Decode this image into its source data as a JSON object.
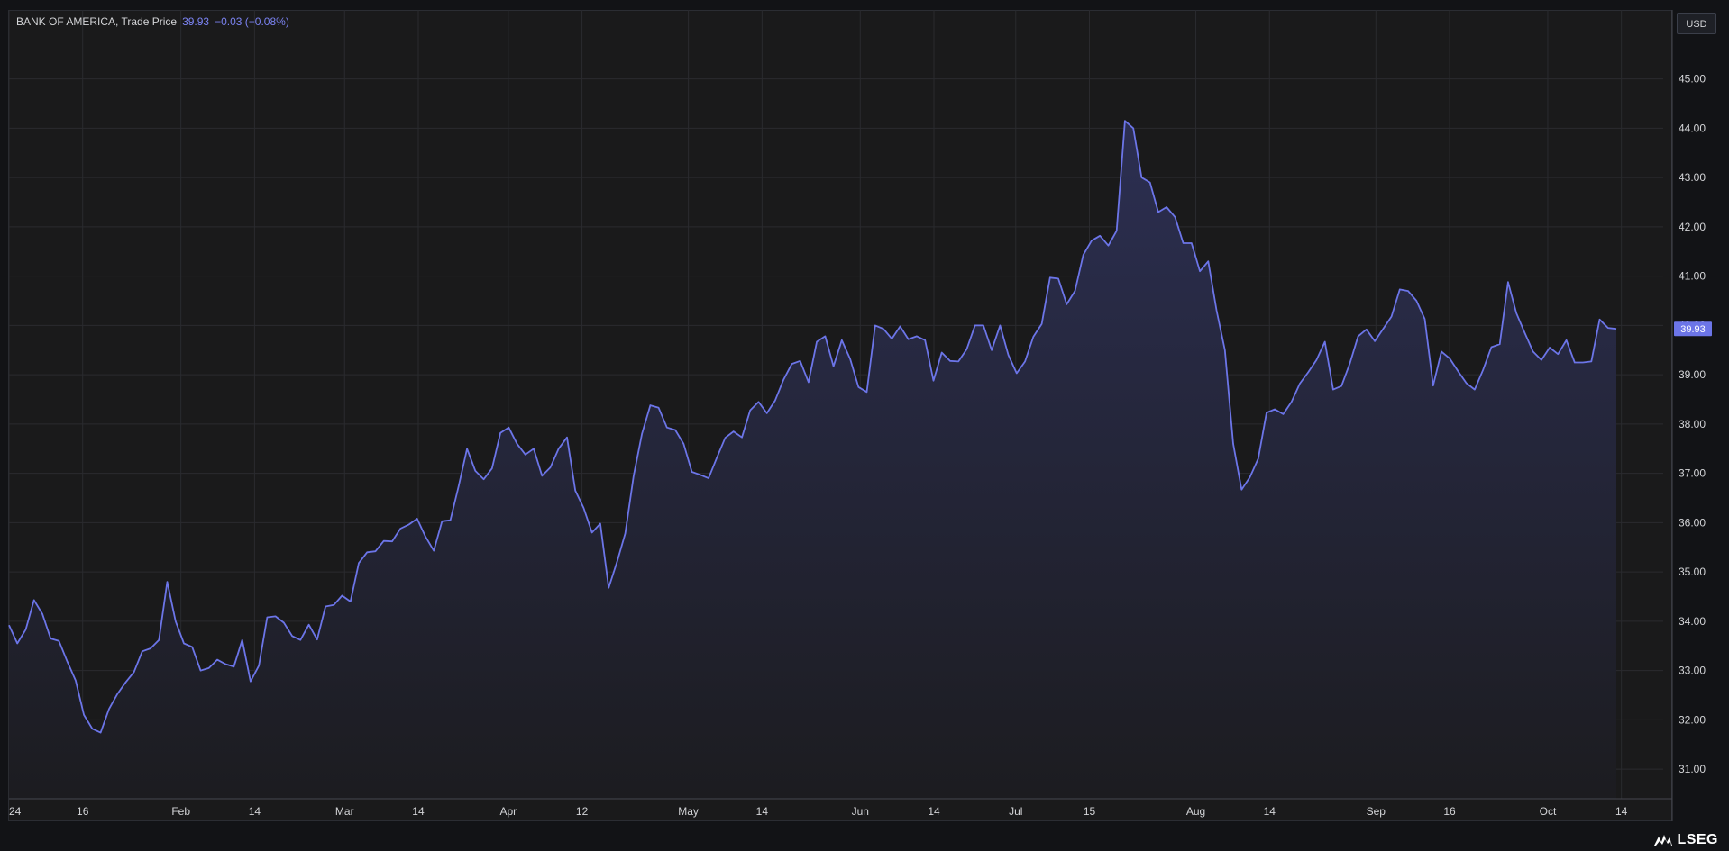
{
  "header": {
    "instrument": "BANK OF AMERICA, Trade Price",
    "last_price": "39.93",
    "change": "−0.03 (−0.08%)",
    "currency": "USD"
  },
  "last_price_tag": "39.93",
  "brand": {
    "name": "LSEG"
  },
  "colors": {
    "line": "#6c75e8",
    "area_top": "#2c2f52",
    "area_bottom": "#1c1c20",
    "grid": "#2a2b2f",
    "background": "#1a1a1b",
    "price_tag": "#6c75e8"
  },
  "chart_data": {
    "type": "area",
    "title": "",
    "xlabel": "",
    "ylabel": "",
    "ylim": [
      30.4,
      46.4
    ],
    "y_ticks": [
      "31.00",
      "32.00",
      "33.00",
      "34.00",
      "35.00",
      "36.00",
      "37.00",
      "38.00",
      "39.00",
      "40.00",
      "41.00",
      "42.00",
      "43.00",
      "44.00",
      "45.00"
    ],
    "x_ticks": [
      {
        "label": "24",
        "day": 0
      },
      {
        "label": "16",
        "day": 9
      },
      {
        "label": "Feb",
        "day": 21
      },
      {
        "label": "14",
        "day": 30
      },
      {
        "label": "Mar",
        "day": 41
      },
      {
        "label": "14",
        "day": 50
      },
      {
        "label": "Apr",
        "day": 61
      },
      {
        "label": "12",
        "day": 70
      },
      {
        "label": "May",
        "day": 83
      },
      {
        "label": "14",
        "day": 92
      },
      {
        "label": "Jun",
        "day": 104
      },
      {
        "label": "14",
        "day": 113
      },
      {
        "label": "Jul",
        "day": 123
      },
      {
        "label": "15",
        "day": 132
      },
      {
        "label": "Aug",
        "day": 145
      },
      {
        "label": "14",
        "day": 154
      },
      {
        "label": "Sep",
        "day": 167
      },
      {
        "label": "16",
        "day": 176
      },
      {
        "label": "Oct",
        "day": 188
      },
      {
        "label": "14",
        "day": 197
      }
    ],
    "x_max": 201,
    "series": [
      {
        "values": [
          33.92,
          33.55,
          33.83,
          34.43,
          34.15,
          33.65,
          33.6,
          33.18,
          32.8,
          32.1,
          31.82,
          31.74,
          32.22,
          32.52,
          32.76,
          32.97,
          33.39,
          33.45,
          33.62,
          34.8,
          34.0,
          33.55,
          33.48,
          33.0,
          33.05,
          33.22,
          33.13,
          33.08,
          33.62,
          32.78,
          33.1,
          34.08,
          34.1,
          33.97,
          33.7,
          33.62,
          33.93,
          33.63,
          34.3,
          34.33,
          34.52,
          34.4,
          35.18,
          35.4,
          35.42,
          35.63,
          35.62,
          35.88,
          35.96,
          36.08,
          35.72,
          35.43,
          36.03,
          36.05,
          36.75,
          37.5,
          37.05,
          36.88,
          37.1,
          37.82,
          37.93,
          37.6,
          37.38,
          37.5,
          36.95,
          37.12,
          37.5,
          37.73,
          36.65,
          36.3,
          35.8,
          35.98,
          34.68,
          35.2,
          35.78,
          36.95,
          37.8,
          38.38,
          38.33,
          37.93,
          37.88,
          37.6,
          37.03,
          36.97,
          36.9,
          37.32,
          37.72,
          37.85,
          37.73,
          38.28,
          38.45,
          38.22,
          38.48,
          38.9,
          39.22,
          39.28,
          38.85,
          39.67,
          39.78,
          39.17,
          39.7,
          39.32,
          38.75,
          38.65,
          40.0,
          39.93,
          39.73,
          39.98,
          39.72,
          39.78,
          39.7,
          38.88,
          39.45,
          39.28,
          39.27,
          39.52,
          40.0,
          40.0,
          39.5,
          40.0,
          39.4,
          39.03,
          39.27,
          39.77,
          40.03,
          40.97,
          40.95,
          40.43,
          40.7,
          41.43,
          41.72,
          41.82,
          41.62,
          41.92,
          44.15,
          44.0,
          43.0,
          42.9,
          42.3,
          42.4,
          42.2,
          41.67,
          41.67,
          41.1,
          41.3,
          40.3,
          39.5,
          37.6,
          36.67,
          36.92,
          37.3,
          38.23,
          38.3,
          38.2,
          38.45,
          38.82,
          39.05,
          39.3,
          39.67,
          38.7,
          38.77,
          39.23,
          39.78,
          39.92,
          39.68,
          39.93,
          40.18,
          40.73,
          40.7,
          40.5,
          40.13,
          38.78,
          39.47,
          39.33,
          39.07,
          38.83,
          38.7,
          39.1,
          39.56,
          39.62,
          40.88,
          40.25,
          39.85,
          39.47,
          39.3,
          39.55,
          39.42,
          39.7,
          39.25,
          39.25,
          39.27,
          40.12,
          39.95,
          39.93
        ]
      }
    ]
  }
}
